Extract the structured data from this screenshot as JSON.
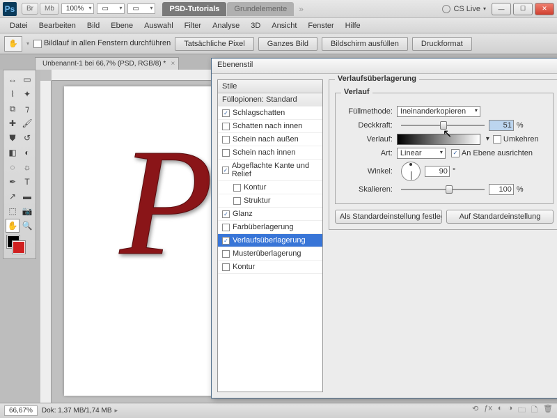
{
  "title_bar": {
    "app_icon": "Ps",
    "buttons": {
      "br": "Br",
      "mb": "Mb"
    },
    "zoom": "100%",
    "tabs": {
      "active": "PSD-Tutorials",
      "inactive": "Grundelemente"
    },
    "cs_live": "CS Live"
  },
  "menu": {
    "datei": "Datei",
    "bearbeiten": "Bearbeiten",
    "bild": "Bild",
    "ebene": "Ebene",
    "auswahl": "Auswahl",
    "filter": "Filter",
    "analyse": "Analyse",
    "dd": "3D",
    "ansicht": "Ansicht",
    "fenster": "Fenster",
    "hilfe": "Hilfe"
  },
  "options": {
    "scroll_all": "Bildlauf in allen Fenstern durchführen",
    "actual_pixels": "Tatsächliche Pixel",
    "fit_screen": "Ganzes Bild",
    "fill_screen": "Bildschirm ausfüllen",
    "print_size": "Druckformat"
  },
  "document": {
    "tab": "Unbenannt-1 bei 66,7% (PSD, RGB/8) *",
    "letter": "P"
  },
  "status": {
    "zoom": "66,67%",
    "doc": "Dok: 1,37 MB/1,74 MB"
  },
  "dialog": {
    "title": "Ebenenstil",
    "left_header": "Stile",
    "items": {
      "blend": "Füllopionen: Standard",
      "drop": "Schlagschatten",
      "inner_shadow": "Schatten nach innen",
      "outer_glow": "Schein nach außen",
      "inner_glow": "Schein nach innen",
      "bevel": "Abgeflachte Kante und Relief",
      "contour": "Kontur",
      "texture": "Struktur",
      "satin": "Glanz",
      "color_ov": "Farbüberlagerung",
      "grad_ov": "Verlaufsüberlagerung",
      "pat_ov": "Musterüberlagerung",
      "stroke": "Kontur"
    },
    "right": {
      "group": "Verlaufsüberlagerung",
      "subgroup": "Verlauf",
      "blend_mode_lbl": "Füllmethode:",
      "blend_mode_val": "Ineinanderkopieren",
      "opacity_lbl": "Deckkraft:",
      "opacity_val": "51",
      "pct": "%",
      "gradient_lbl": "Verlauf:",
      "reverse": "Umkehren",
      "style_lbl": "Art:",
      "style_val": "Linear",
      "align": "An Ebene ausrichten",
      "angle_lbl": "Winkel:",
      "angle_val": "90",
      "deg": "°",
      "scale_lbl": "Skalieren:",
      "scale_val": "100",
      "make_default": "Als Standardeinstellung festlegen",
      "reset_default": "Auf Standardeinstellung"
    }
  }
}
